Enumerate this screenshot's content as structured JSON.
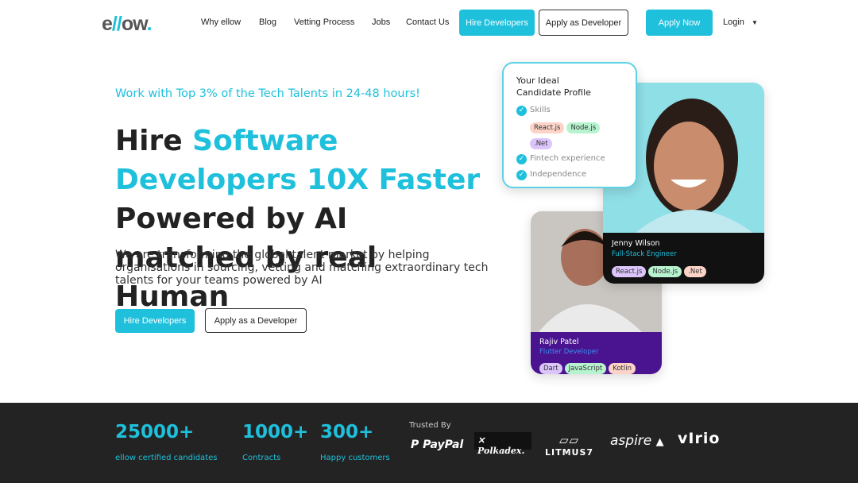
{
  "nav": {
    "logo": "ellow",
    "links": [
      "Why ellow",
      "Blog",
      "Vetting Process",
      "Jobs",
      "Contact Us"
    ],
    "hire": "Hire Developers",
    "apply_dev": "Apply as Developer",
    "apply_now": "Apply Now",
    "login": "Login"
  },
  "hero": {
    "tagline": "Work with Top 3% of the Tech Talents in 24-48 hours!",
    "h_1": "Hire ",
    "h_2": "Software Developers 10X Faster",
    "h_3": " Powered by AI matched by real Human",
    "subtitle": "We are transforming the global talent market by helping organisations in sourcing, vetting and matching extraordinary tech talents for your teams powered by AI",
    "hire_btn": "Hire Developers",
    "apply_btn": "Apply as a Developer"
  },
  "profile": {
    "title": "Your Ideal Candidate Profile",
    "items": [
      "Skills",
      "Fintech experience",
      "Independence"
    ],
    "skills": [
      "React.js",
      "Node.js",
      ".Net"
    ]
  },
  "jenny": {
    "name": "Jenny Wilson",
    "role": "Full-Stack Engineer",
    "tags": [
      "React.js",
      "Node.js",
      ".Net"
    ]
  },
  "rajiv": {
    "name": "Rajiv Patel",
    "role": "Flutter Developer",
    "tags": [
      "Dart",
      "JavaScript",
      "Kotlin"
    ]
  },
  "stats": [
    {
      "n": "25000+",
      "l": "ellow certified candidates"
    },
    {
      "n": "1000+",
      "l": "Contracts"
    },
    {
      "n": "300+",
      "l": "Happy customers"
    }
  ],
  "trusted": {
    "label": "Trusted By",
    "brands": [
      "PayPal",
      "Polkadex.",
      "LITMUS7",
      "aspire",
      "vIrio"
    ]
  },
  "colors": {
    "accent": "#1ec0dc",
    "footer": "#232323",
    "rajiv_band": "#4a1490"
  }
}
